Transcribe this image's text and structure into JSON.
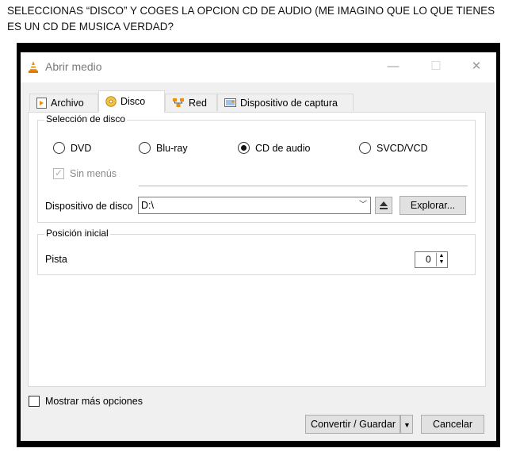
{
  "caption": {
    "line1": "SELECCIONAS “DISCO”  Y COGES LA OPCION CD DE AUDIO  (ME IMAGINO QUE LO QUE TIENES",
    "line2": "ES UN CD DE MUSICA VERDAD?"
  },
  "window": {
    "title": "Abrir medio",
    "minimize": "—",
    "maximize": "☐",
    "close": "✕"
  },
  "tabs": [
    {
      "label": "Archivo",
      "icon": "file-play-icon"
    },
    {
      "label": "Disco",
      "icon": "disc-icon",
      "active": true
    },
    {
      "label": "Red",
      "icon": "network-icon"
    },
    {
      "label": "Dispositivo de captura",
      "icon": "capture-device-icon"
    }
  ],
  "disc_selection": {
    "legend": "Selección de disco",
    "options": [
      {
        "label": "DVD",
        "selected": false
      },
      {
        "label": "Blu-ray",
        "selected": false
      },
      {
        "label": "CD de audio",
        "selected": true
      },
      {
        "label": "SVCD/VCD",
        "selected": false
      }
    ],
    "no_menus": {
      "label": "Sin menús",
      "checked": true,
      "disabled": true
    },
    "device_label": "Dispositivo de disco",
    "device_value": "D:\\",
    "eject_icon": "eject-icon",
    "browse_label": "Explorar..."
  },
  "start_position": {
    "legend": "Posición inicial",
    "track_label": "Pista",
    "track_value": "0"
  },
  "footer": {
    "more_options_label": "Mostrar más opciones",
    "convert_label": "Convertir / Guardar",
    "cancel_label": "Cancelar"
  },
  "colors": {
    "vlc_orange": "#f28c00",
    "window_bg": "#f0f0f0"
  }
}
